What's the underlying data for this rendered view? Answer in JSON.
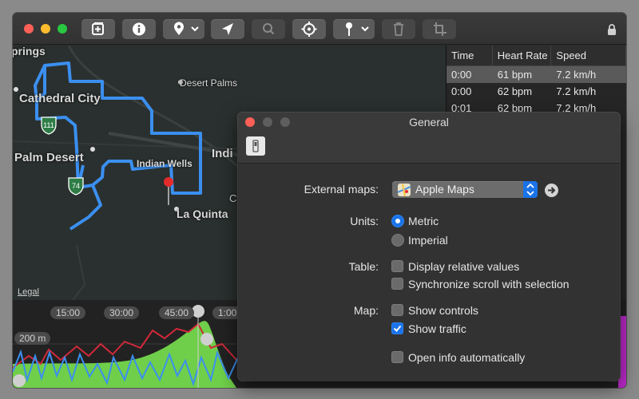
{
  "toolbar": {
    "buttons": [
      "add-photo-icon",
      "info-icon",
      "location-pin-icon",
      "navigate-arrow-icon",
      "magnifier-icon",
      "crosshair-icon",
      "map-pin-icon",
      "trash-icon",
      "crop-icon"
    ],
    "locked_icon": "lock-icon"
  },
  "map": {
    "place_labels": [
      "prings",
      "Cathedral City",
      "Desert Palms",
      "Palm Desert",
      "Indian Wells",
      "Indi",
      "La Quinta",
      "C"
    ],
    "route_shields": [
      "111",
      "74"
    ],
    "legal": "Legal",
    "route_color": "#3b8ff0",
    "marker_color": "#e32b2b"
  },
  "table": {
    "columns": [
      "Time",
      "Heart Rate",
      "Speed"
    ],
    "rows": [
      [
        "0:00",
        "61 bpm",
        "7.2 km/h"
      ],
      [
        "0:00",
        "62 bpm",
        "7.2 km/h"
      ],
      [
        "0:01",
        "62 bpm",
        "7.2 km/h"
      ]
    ],
    "selected_row": 0
  },
  "chart": {
    "time_ticks": [
      "15:00",
      "30:00",
      "45:00",
      "1:00"
    ],
    "elevation_tick": "200 m",
    "series_colors": {
      "elevation": "#6fcf4a",
      "heart_rate": "#d0293a",
      "speed": "#3b8ff0"
    }
  },
  "prefs": {
    "title": "General",
    "external_maps_label": "External maps:",
    "external_maps_value": "Apple Maps",
    "units_label": "Units:",
    "units_options": [
      "Metric",
      "Imperial"
    ],
    "units_selected": "Metric",
    "table_label": "Table:",
    "table_options": [
      {
        "label": "Display relative values",
        "checked": false
      },
      {
        "label": "Synchronize scroll with selection",
        "checked": false
      }
    ],
    "map_label": "Map:",
    "map_options": [
      {
        "label": "Show controls",
        "checked": false
      },
      {
        "label": "Show traffic",
        "checked": true
      },
      {
        "label": "Open info automatically",
        "checked": false
      }
    ],
    "accent": "#1a73e8"
  }
}
